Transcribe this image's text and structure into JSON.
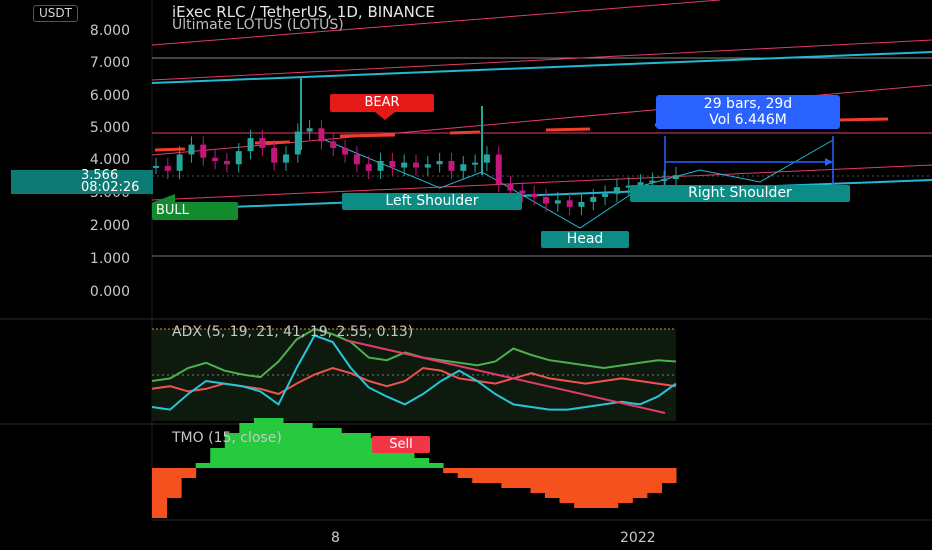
{
  "header": {
    "currency": "USDT",
    "title": "iExec RLC / TetherUS, 1D, BINANCE",
    "indicator": "Ultimate LOTUS (LOTUS)"
  },
  "price_tag": {
    "price": "3.566",
    "countdown": "08:02:26"
  },
  "annotations": {
    "bear": "BEAR",
    "bull": "BULL",
    "left_shoulder": "Left Shoulder",
    "right_shoulder": "Right Shoulder",
    "head": "Head",
    "range_line1": "29 bars, 29d",
    "range_line2": "Vol 6.446M",
    "sell": "Sell"
  },
  "panes": {
    "adx_label": "ADX (5, 19, 21, 41, 19, 2.55, 0.13)",
    "tmo_label": "TMO (15, close)"
  },
  "colors": {
    "background": "#000000",
    "candle_up": "#26a69a",
    "candle_down": "#c2187a",
    "channel": "#22b8d6",
    "trendline": "#e23b6a",
    "resistance": "#f23d2d",
    "adx_green": "#4caf50",
    "adx_red": "#ef5350",
    "adx_cyan": "#26c6da",
    "tmo_up": "#27c93f",
    "tmo_down": "#f4511e",
    "range_box": "#2962ff"
  },
  "chart_data": [
    {
      "type": "candlestick",
      "title": "iExec RLC / TetherUS, 1D, BINANCE",
      "y_ticks": [
        "8.000",
        "7.000",
        "6.000",
        "5.000",
        "4.000",
        "3.000",
        "2.000",
        "1.000",
        "0.000"
      ],
      "ylim": [
        0,
        8
      ],
      "x_ticks": [
        "8",
        "2022"
      ],
      "last_price": 3.566,
      "close_path": [
        3.85,
        3.7,
        4.2,
        4.5,
        4.1,
        4.0,
        3.9,
        4.3,
        4.7,
        4.4,
        3.95,
        4.2,
        4.9,
        5.0,
        4.6,
        4.4,
        4.2,
        3.9,
        3.7,
        4.0,
        3.8,
        3.95,
        3.8,
        3.9,
        4.0,
        3.7,
        3.9,
        3.95,
        4.2,
        3.3,
        3.1,
        3.0,
        2.9,
        2.7,
        2.8,
        2.6,
        2.75,
        2.9,
        3.0,
        3.2,
        3.25,
        3.35,
        3.4,
        3.45,
        3.566
      ]
    },
    {
      "type": "line",
      "title": "ADX (5, 19, 21, 41, 19, 2.55, 0.13)",
      "series": [
        {
          "values": [
            30,
            32,
            40,
            44,
            38,
            35,
            33,
            45,
            62,
            70,
            66,
            60,
            48,
            46,
            52,
            48,
            46,
            44,
            42,
            45,
            55,
            50,
            46,
            44,
            42,
            40,
            42,
            44,
            46,
            45
          ]
        },
        {
          "values": [
            24,
            26,
            22,
            24,
            28,
            26,
            24,
            20,
            28,
            35,
            40,
            36,
            30,
            26,
            30,
            40,
            38,
            32,
            30,
            28,
            32,
            36,
            32,
            30,
            28,
            30,
            32,
            30,
            28,
            26
          ]
        },
        {
          "values": [
            10,
            8,
            20,
            30,
            28,
            26,
            22,
            12,
            40,
            65,
            60,
            40,
            25,
            18,
            12,
            20,
            30,
            38,
            30,
            20,
            12,
            10,
            8,
            8,
            10,
            12,
            14,
            12,
            18,
            28
          ]
        }
      ]
    },
    {
      "type": "bar",
      "title": "TMO (15, close)",
      "values": [
        -10,
        -6,
        -2,
        1,
        4,
        7,
        9,
        10,
        10,
        9,
        9,
        8,
        8,
        7,
        7,
        6,
        5,
        4,
        2,
        1,
        -1,
        -2,
        -3,
        -3,
        -4,
        -4,
        -5,
        -6,
        -7,
        -8,
        -8,
        -8,
        -7,
        -6,
        -5,
        -3
      ]
    }
  ]
}
